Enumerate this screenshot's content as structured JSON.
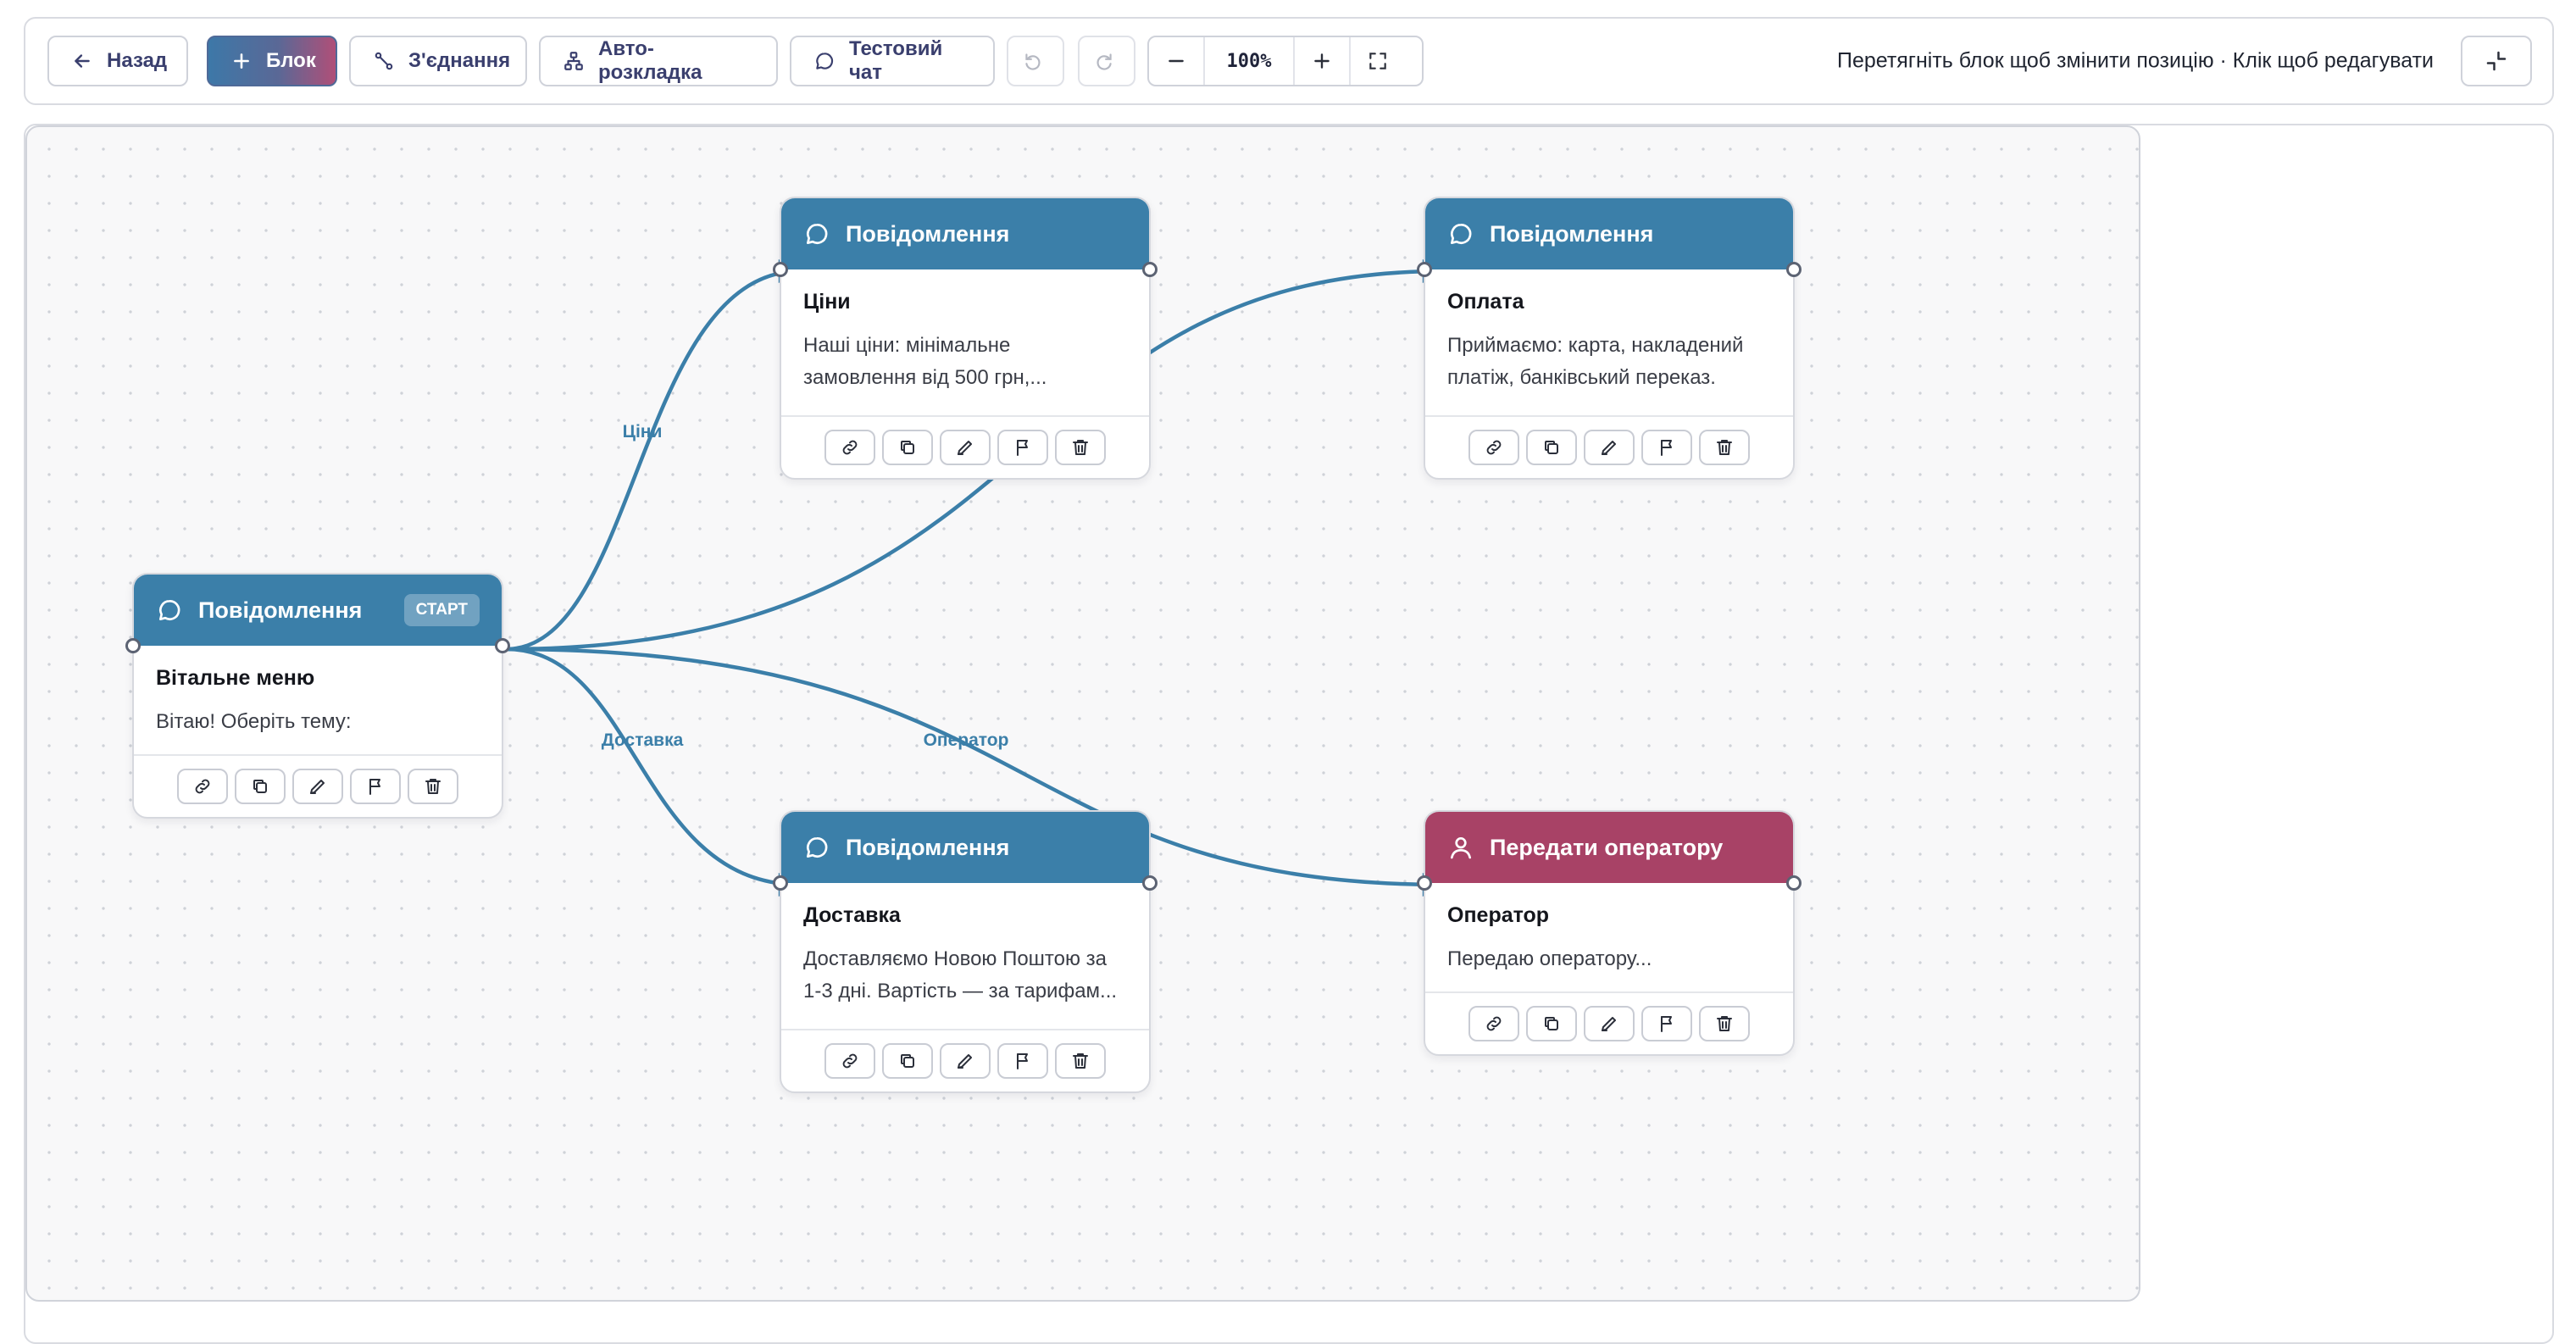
{
  "toolbar": {
    "back": "Назад",
    "add_block": "Блок",
    "connect": "З'єднання",
    "auto_layout": "Авто-розкладка",
    "test_chat": "Тестовий чат",
    "zoom": "100%",
    "hint": "Перетягніть блок щоб змінити позицію · Клік щоб редагувати"
  },
  "colors": {
    "message_header": "#3b7fa9",
    "operator_header": "#a84266",
    "edge": "#3b7fa9"
  },
  "nodes": [
    {
      "type": "Повідомлення",
      "badge": "СТАРТ",
      "title": "Вітальне меню",
      "text": "Вітаю! Оберіть тему:"
    },
    {
      "type": "Повідомлення",
      "title": "Ціни",
      "text": "Наші ціни: мінімальне замовлення від 500 грн,..."
    },
    {
      "type": "Повідомлення",
      "title": "Оплата",
      "text": "Приймаємо: карта, накладений платіж, банківський переказ."
    },
    {
      "type": "Повідомлення",
      "title": "Доставка",
      "text": "Доставляємо Новою Поштою за 1-3 дні. Вартість — за тарифам..."
    },
    {
      "type": "Передати оператору",
      "title": "Оператор",
      "text": "Передаю оператору..."
    }
  ],
  "edges": [
    {
      "from": "Вітальне меню",
      "to": "Ціни",
      "label": "Ціни"
    },
    {
      "from": "Вітальне меню",
      "to": "Доставка",
      "label": "Доставка"
    },
    {
      "from": "Вітальне меню",
      "to": "Оператор",
      "label": "Оператор"
    },
    {
      "from": "Вітальне меню",
      "to": "Оплата",
      "label": ""
    }
  ],
  "node_actions": [
    "link-icon",
    "duplicate-icon",
    "edit-icon",
    "flag-icon",
    "trash-icon"
  ]
}
